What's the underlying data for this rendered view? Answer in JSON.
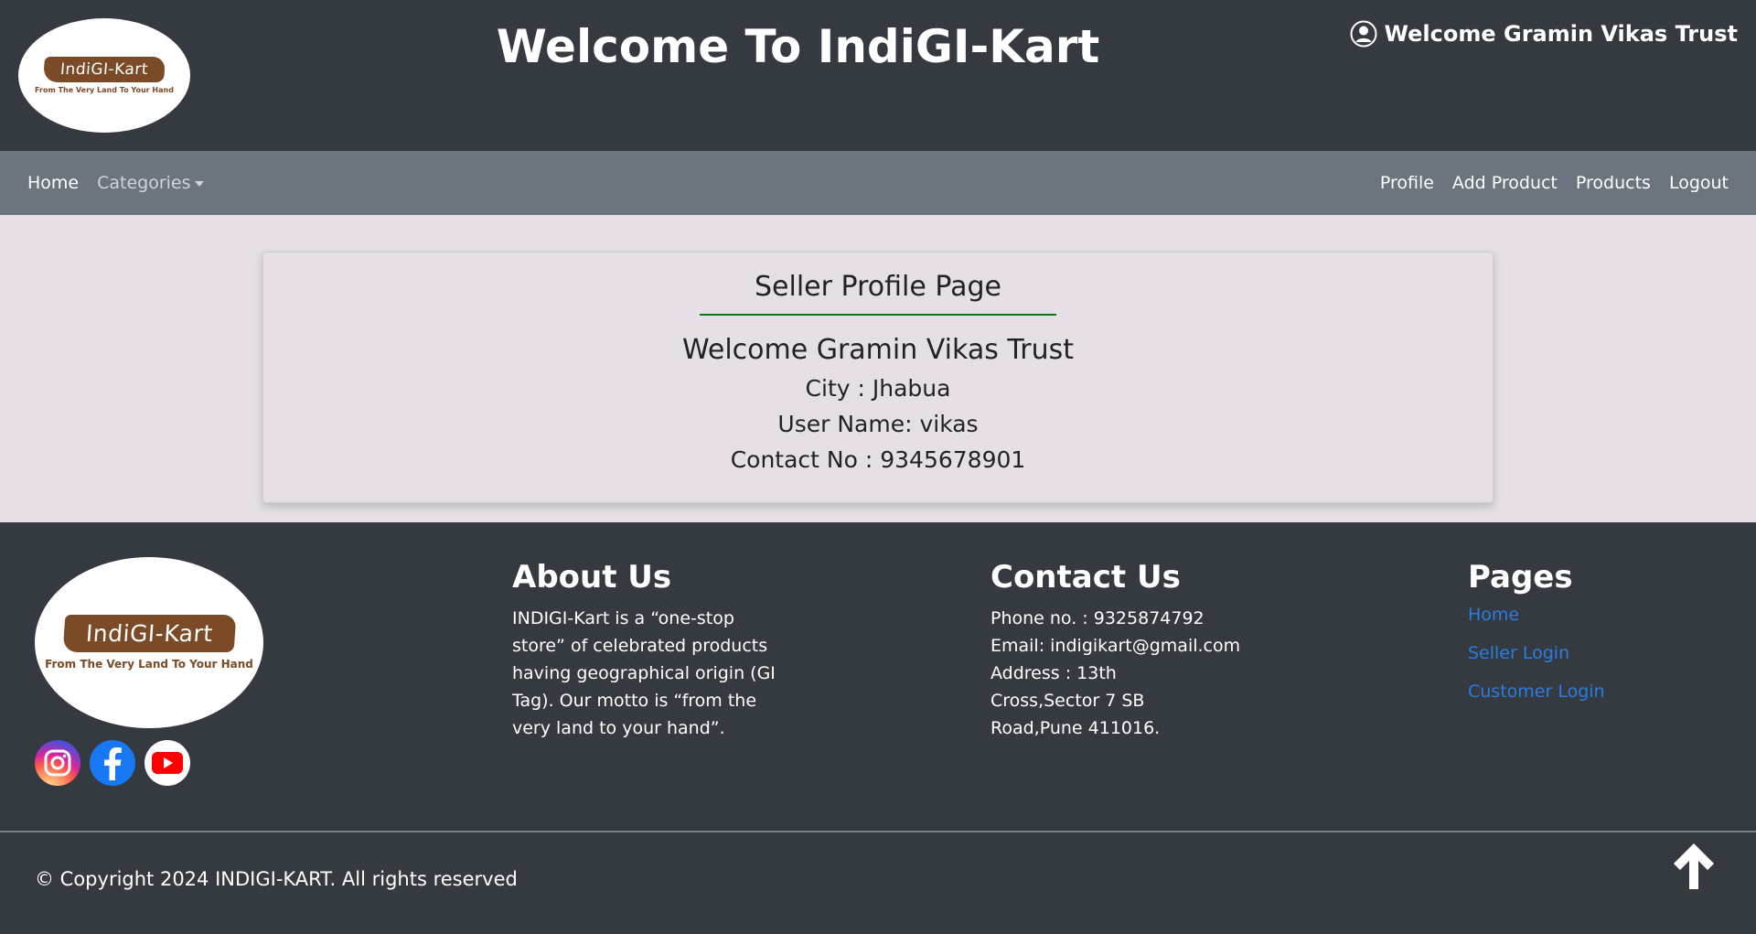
{
  "header": {
    "logo_text": "IndiGI-Kart",
    "logo_tagline": "From The Very Land To Your Hand",
    "title": "Welcome To IndiGI-Kart",
    "user_welcome": "Welcome Gramin Vikas Trust"
  },
  "navbar": {
    "left": [
      "Home",
      "Categories"
    ],
    "right": [
      "Profile",
      "Add Product",
      "Products",
      "Logout"
    ]
  },
  "profile": {
    "page_title": "Seller Profile Page",
    "welcome": "Welcome Gramin Vikas Trust",
    "city": "City : Jhabua",
    "username": "User Name: vikas",
    "contact": "Contact No : 9345678901"
  },
  "footer": {
    "logo_text": "IndiGI-Kart",
    "logo_tagline": "From The Very Land To Your Hand",
    "about": {
      "heading": "About Us",
      "text": "INDIGI-Kart is a “one-stop store” of celebrated products having geographical origin (GI Tag). Our motto is “from the very land to your hand”."
    },
    "contact": {
      "heading": "Contact Us",
      "phone": "Phone no. : 9325874792",
      "email": "Email: indigikart@gmail.com",
      "address": "Address : 13th Cross,Sector 7 SB Road,Pune 411016."
    },
    "pages": {
      "heading": "Pages",
      "links": [
        "Home",
        "Seller Login",
        "Customer Login"
      ]
    },
    "socials": [
      "instagram-icon",
      "facebook-icon",
      "youtube-icon"
    ],
    "copyright": "© Copyright 2024 INDIGI-KART. All rights reserved"
  },
  "colors": {
    "header_bg": "#343a40",
    "navbar_bg": "#6c757d",
    "main_bg": "#e6e0e6",
    "link": "#2a7de1",
    "underline": "#0a7a0a",
    "logo_brown": "#7b4a26"
  }
}
